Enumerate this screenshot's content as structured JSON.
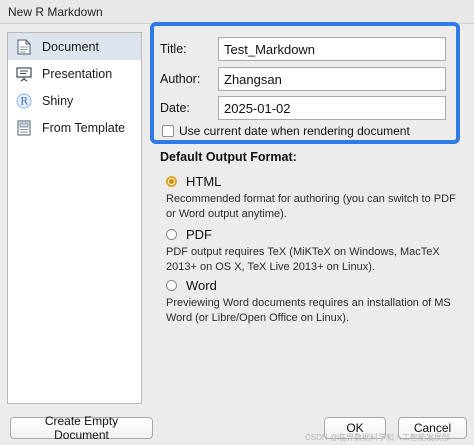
{
  "window": {
    "title": "New R Markdown"
  },
  "sidebar": {
    "items": [
      {
        "label": "Document",
        "icon": "document-icon",
        "selected": true
      },
      {
        "label": "Presentation",
        "icon": "presentation-icon",
        "selected": false
      },
      {
        "label": "Shiny",
        "icon": "shiny-r-icon",
        "selected": false
      },
      {
        "label": "From Template",
        "icon": "template-icon",
        "selected": false
      }
    ]
  },
  "fields": {
    "title_label": "Title:",
    "title_value": "Test_Markdown",
    "author_label": "Author:",
    "author_value": "Zhangsan",
    "date_label": "Date:",
    "date_value": "2025-01-02",
    "use_current_date_label": "Use current date when rendering document",
    "use_current_date_checked": false
  },
  "output": {
    "section_title": "Default Output Format:",
    "options": [
      {
        "label": "HTML",
        "selected": true,
        "description": "Recommended format for authoring (you can switch to PDF or Word output anytime)."
      },
      {
        "label": "PDF",
        "selected": false,
        "description": "PDF output requires TeX (MiKTeX on Windows, MacTeX 2013+ on OS X, TeX Live 2013+ on Linux)."
      },
      {
        "label": "Word",
        "selected": false,
        "description": "Previewing Word documents requires an installation of MS Word (or Libre/Open Office on Linux)."
      }
    ]
  },
  "buttons": {
    "create_empty": "Create Empty Document",
    "ok": "OK",
    "cancel": "Cancel"
  },
  "watermark": "CSDN @临界数据科学和人工智能发展部",
  "colors": {
    "highlight_border": "#2f7ae5",
    "selected_item_bg": "#dde4ee",
    "radio_accent": "#e0a422"
  }
}
